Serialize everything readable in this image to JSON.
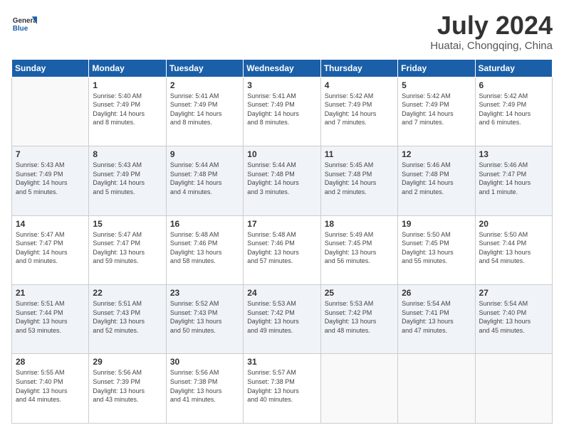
{
  "logo": {
    "text_general": "General",
    "text_blue": "Blue"
  },
  "title": "July 2024",
  "subtitle": "Huatai, Chongqing, China",
  "header_days": [
    "Sunday",
    "Monday",
    "Tuesday",
    "Wednesday",
    "Thursday",
    "Friday",
    "Saturday"
  ],
  "weeks": [
    [
      {
        "day": "",
        "info": ""
      },
      {
        "day": "1",
        "info": "Sunrise: 5:40 AM\nSunset: 7:49 PM\nDaylight: 14 hours\nand 8 minutes."
      },
      {
        "day": "2",
        "info": "Sunrise: 5:41 AM\nSunset: 7:49 PM\nDaylight: 14 hours\nand 8 minutes."
      },
      {
        "day": "3",
        "info": "Sunrise: 5:41 AM\nSunset: 7:49 PM\nDaylight: 14 hours\nand 8 minutes."
      },
      {
        "day": "4",
        "info": "Sunrise: 5:42 AM\nSunset: 7:49 PM\nDaylight: 14 hours\nand 7 minutes."
      },
      {
        "day": "5",
        "info": "Sunrise: 5:42 AM\nSunset: 7:49 PM\nDaylight: 14 hours\nand 7 minutes."
      },
      {
        "day": "6",
        "info": "Sunrise: 5:42 AM\nSunset: 7:49 PM\nDaylight: 14 hours\nand 6 minutes."
      }
    ],
    [
      {
        "day": "7",
        "info": "Sunrise: 5:43 AM\nSunset: 7:49 PM\nDaylight: 14 hours\nand 5 minutes."
      },
      {
        "day": "8",
        "info": "Sunrise: 5:43 AM\nSunset: 7:49 PM\nDaylight: 14 hours\nand 5 minutes."
      },
      {
        "day": "9",
        "info": "Sunrise: 5:44 AM\nSunset: 7:48 PM\nDaylight: 14 hours\nand 4 minutes."
      },
      {
        "day": "10",
        "info": "Sunrise: 5:44 AM\nSunset: 7:48 PM\nDaylight: 14 hours\nand 3 minutes."
      },
      {
        "day": "11",
        "info": "Sunrise: 5:45 AM\nSunset: 7:48 PM\nDaylight: 14 hours\nand 2 minutes."
      },
      {
        "day": "12",
        "info": "Sunrise: 5:46 AM\nSunset: 7:48 PM\nDaylight: 14 hours\nand 2 minutes."
      },
      {
        "day": "13",
        "info": "Sunrise: 5:46 AM\nSunset: 7:47 PM\nDaylight: 14 hours\nand 1 minute."
      }
    ],
    [
      {
        "day": "14",
        "info": "Sunrise: 5:47 AM\nSunset: 7:47 PM\nDaylight: 14 hours\nand 0 minutes."
      },
      {
        "day": "15",
        "info": "Sunrise: 5:47 AM\nSunset: 7:47 PM\nDaylight: 13 hours\nand 59 minutes."
      },
      {
        "day": "16",
        "info": "Sunrise: 5:48 AM\nSunset: 7:46 PM\nDaylight: 13 hours\nand 58 minutes."
      },
      {
        "day": "17",
        "info": "Sunrise: 5:48 AM\nSunset: 7:46 PM\nDaylight: 13 hours\nand 57 minutes."
      },
      {
        "day": "18",
        "info": "Sunrise: 5:49 AM\nSunset: 7:45 PM\nDaylight: 13 hours\nand 56 minutes."
      },
      {
        "day": "19",
        "info": "Sunrise: 5:50 AM\nSunset: 7:45 PM\nDaylight: 13 hours\nand 55 minutes."
      },
      {
        "day": "20",
        "info": "Sunrise: 5:50 AM\nSunset: 7:44 PM\nDaylight: 13 hours\nand 54 minutes."
      }
    ],
    [
      {
        "day": "21",
        "info": "Sunrise: 5:51 AM\nSunset: 7:44 PM\nDaylight: 13 hours\nand 53 minutes."
      },
      {
        "day": "22",
        "info": "Sunrise: 5:51 AM\nSunset: 7:43 PM\nDaylight: 13 hours\nand 52 minutes."
      },
      {
        "day": "23",
        "info": "Sunrise: 5:52 AM\nSunset: 7:43 PM\nDaylight: 13 hours\nand 50 minutes."
      },
      {
        "day": "24",
        "info": "Sunrise: 5:53 AM\nSunset: 7:42 PM\nDaylight: 13 hours\nand 49 minutes."
      },
      {
        "day": "25",
        "info": "Sunrise: 5:53 AM\nSunset: 7:42 PM\nDaylight: 13 hours\nand 48 minutes."
      },
      {
        "day": "26",
        "info": "Sunrise: 5:54 AM\nSunset: 7:41 PM\nDaylight: 13 hours\nand 47 minutes."
      },
      {
        "day": "27",
        "info": "Sunrise: 5:54 AM\nSunset: 7:40 PM\nDaylight: 13 hours\nand 45 minutes."
      }
    ],
    [
      {
        "day": "28",
        "info": "Sunrise: 5:55 AM\nSunset: 7:40 PM\nDaylight: 13 hours\nand 44 minutes."
      },
      {
        "day": "29",
        "info": "Sunrise: 5:56 AM\nSunset: 7:39 PM\nDaylight: 13 hours\nand 43 minutes."
      },
      {
        "day": "30",
        "info": "Sunrise: 5:56 AM\nSunset: 7:38 PM\nDaylight: 13 hours\nand 41 minutes."
      },
      {
        "day": "31",
        "info": "Sunrise: 5:57 AM\nSunset: 7:38 PM\nDaylight: 13 hours\nand 40 minutes."
      },
      {
        "day": "",
        "info": ""
      },
      {
        "day": "",
        "info": ""
      },
      {
        "day": "",
        "info": ""
      }
    ]
  ]
}
